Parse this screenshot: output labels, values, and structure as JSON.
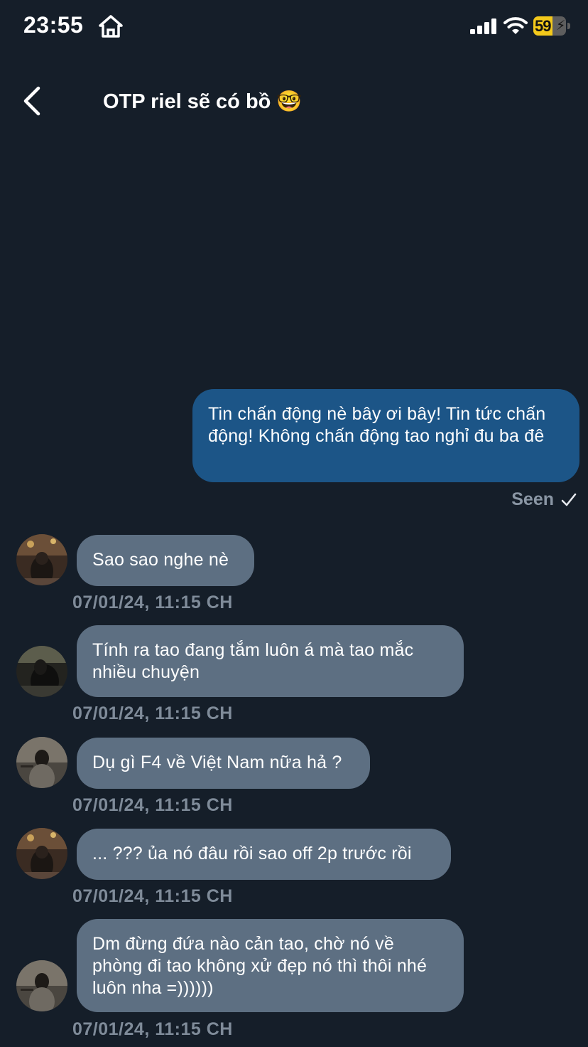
{
  "status_bar": {
    "time": "23:55",
    "battery_level": "59",
    "battery_percent": 0.59,
    "accent_color": "#f3c91b"
  },
  "header": {
    "title": "OTP riel sẽ có bồ 🤓",
    "back_icon": "chevron-left-icon"
  },
  "messages": {
    "outgoing": [
      {
        "text": "Tin chấn động nè bây ơi bây! Tin tức chấn động! Không chấn động tao nghỉ đu ba đê"
      }
    ],
    "seen_label": "Seen",
    "incoming": [
      {
        "text": "Sao sao nghe nè",
        "time": "07/01/24, 11:15 CH"
      },
      {
        "text": "Tính ra tao đang tắm luôn á mà tao mắc nhiều chuyện",
        "time": "07/01/24, 11:15 CH"
      },
      {
        "text": "Dụ gì F4 về Việt Nam nữa hả ?",
        "time": "07/01/24, 11:15 CH"
      },
      {
        "text": "... ??? ủa nó đâu rồi sao off 2p trước rồi",
        "time": "07/01/24, 11:15 CH"
      },
      {
        "text": "Dm đừng đứa nào cản tao, chờ nó về phòng đi tao không xử đẹp nó thì thôi nhé luôn nha =))))))",
        "time": "07/01/24, 11:15 CH"
      }
    ]
  },
  "colors": {
    "background": "#151e29",
    "outgoing_bubble": "#1c5587",
    "incoming_bubble": "#5d6f82",
    "meta_text": "#7f8b99"
  }
}
